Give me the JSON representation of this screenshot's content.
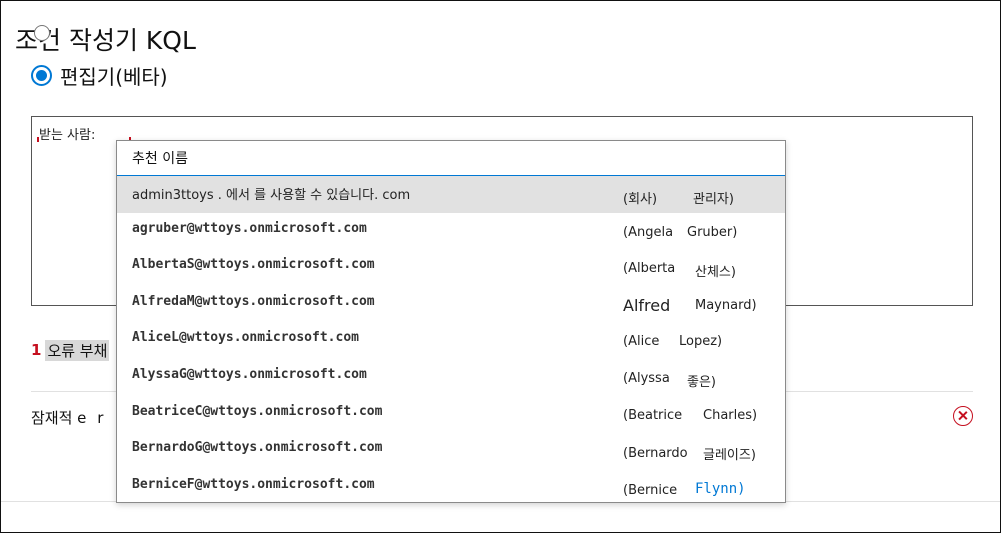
{
  "header": {
    "title": "조건 작성기 KQL",
    "mode_label": "편집기(베타)"
  },
  "editor": {
    "text": "받는 사람:"
  },
  "suggestions": {
    "header": "추천 이름",
    "items": [
      {
        "email": "admin3ttoys . 에서 를 사용할 수 있습니다. com",
        "first": "(회사)",
        "last": "관리자)"
      },
      {
        "email": "agruber@wttoys.onmicrosoft.com",
        "first": "(Angela",
        "last": "Gruber)"
      },
      {
        "email": "AlbertaS@wttoys.onmicrosoft.com",
        "first": "(Alberta",
        "last": "산체스)"
      },
      {
        "email": "AlfredaM@wttoys.onmicrosoft.com",
        "first": "Alfred",
        "last": "Maynard)"
      },
      {
        "email": "AliceL@wttoys.onmicrosoft.com",
        "first": "(Alice",
        "last": "Lopez)"
      },
      {
        "email": "AlyssaG@wttoys.onmicrosoft.com",
        "first": "(Alyssa",
        "last": "좋은)"
      },
      {
        "email": "BeatriceC@wttoys.onmicrosoft.com",
        "first": "(Beatrice",
        "last": "Charles)"
      },
      {
        "email": "BernardoG@wttoys.onmicrosoft.com",
        "first": "(Bernardo",
        "last": "글레이즈)"
      },
      {
        "email": "BerniceF@wttoys.onmicrosoft.com",
        "first": "(Bernice",
        "last": "Flynn)"
      }
    ]
  },
  "errors": {
    "count": "1",
    "label": "오류 부채"
  },
  "property_row": {
    "label": "잠재적 e",
    "value": "r"
  },
  "colors": {
    "accent": "#0078d4",
    "error": "#c50f1f",
    "selected_row": "#e1e1e1"
  }
}
